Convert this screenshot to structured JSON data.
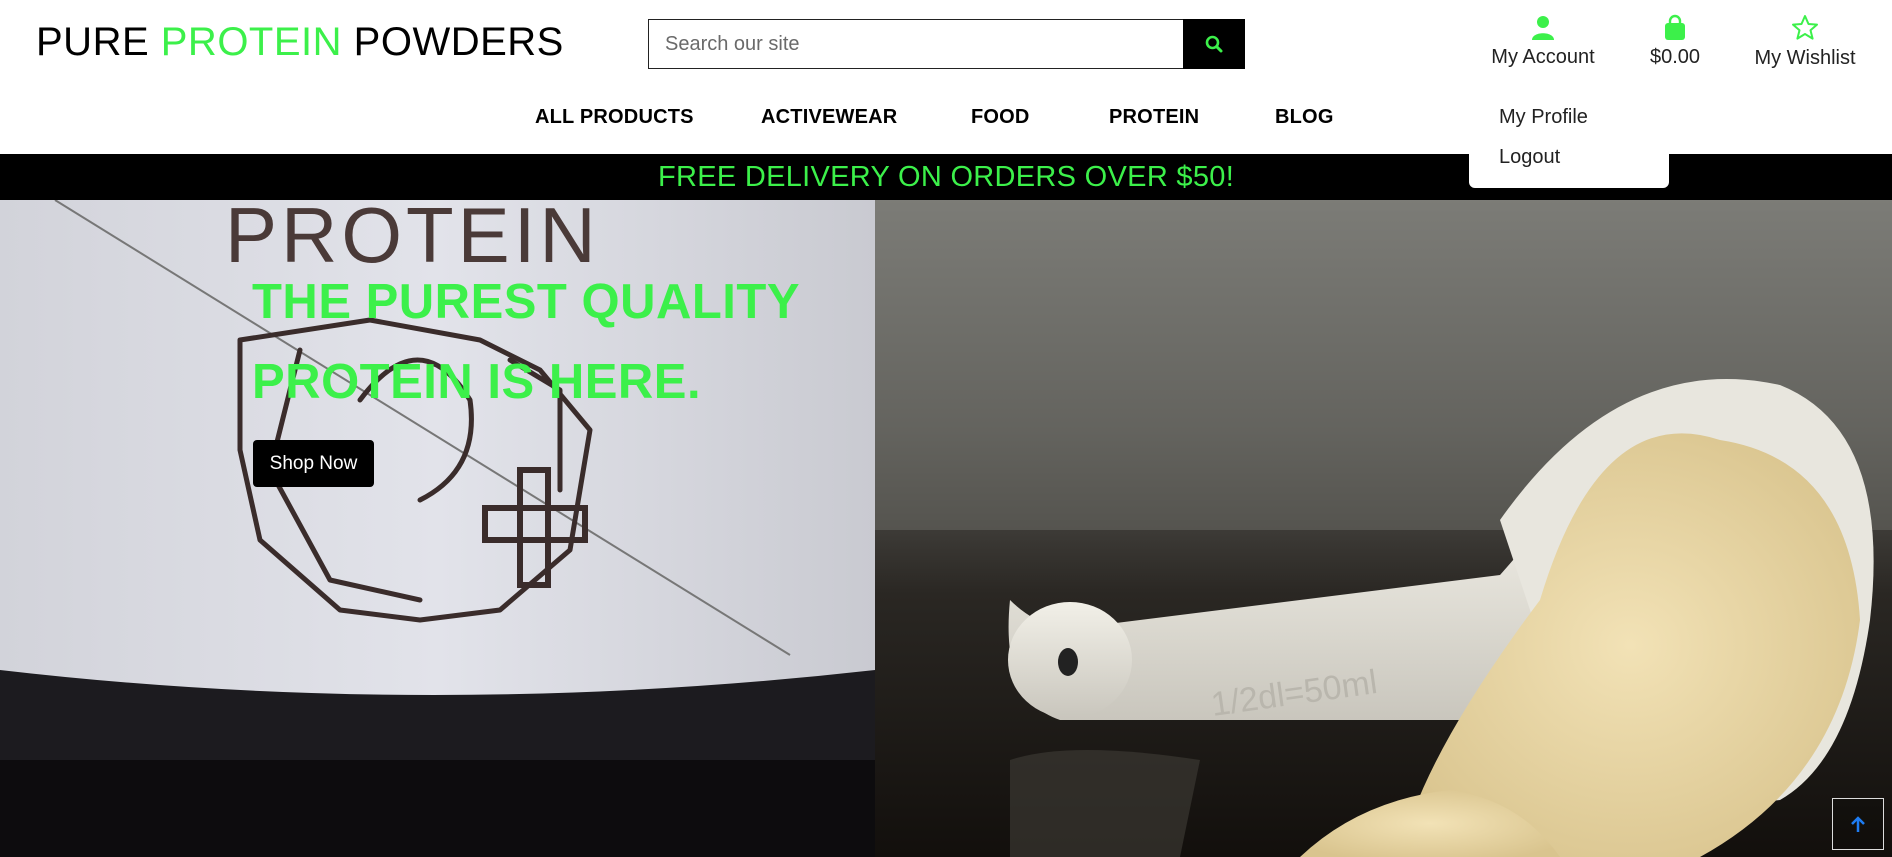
{
  "header": {
    "logo": {
      "part1": "PURE ",
      "part2": "PROTEIN",
      "part3": " POWDERS"
    },
    "search": {
      "placeholder": "Search our site",
      "value": ""
    },
    "account_label": "My Account",
    "bag_total": "$0.00",
    "wishlist_label": "My Wishlist"
  },
  "nav": {
    "items": [
      {
        "label": "ALL PRODUCTS"
      },
      {
        "label": "ACTIVEWEAR"
      },
      {
        "label": "FOOD"
      },
      {
        "label": "PROTEIN"
      },
      {
        "label": "BLOG"
      }
    ]
  },
  "account_menu": {
    "items": [
      {
        "label": "My Profile"
      },
      {
        "label": "Logout"
      }
    ]
  },
  "banner": {
    "text": "FREE DELIVERY ON ORDERS OVER $50!"
  },
  "hero": {
    "title": "THE PUREST QUALITY PROTEIN IS HERE.",
    "button_label": "Shop Now",
    "tub_label": "PROTEIN",
    "scoop_marking": "1/2dl=50ml"
  },
  "colors": {
    "accent": "#3cf04a",
    "black": "#000000",
    "text": "#222222"
  },
  "icons": [
    "search-icon",
    "user-icon",
    "shopping-bag-icon",
    "star-icon",
    "arrow-up-icon"
  ]
}
